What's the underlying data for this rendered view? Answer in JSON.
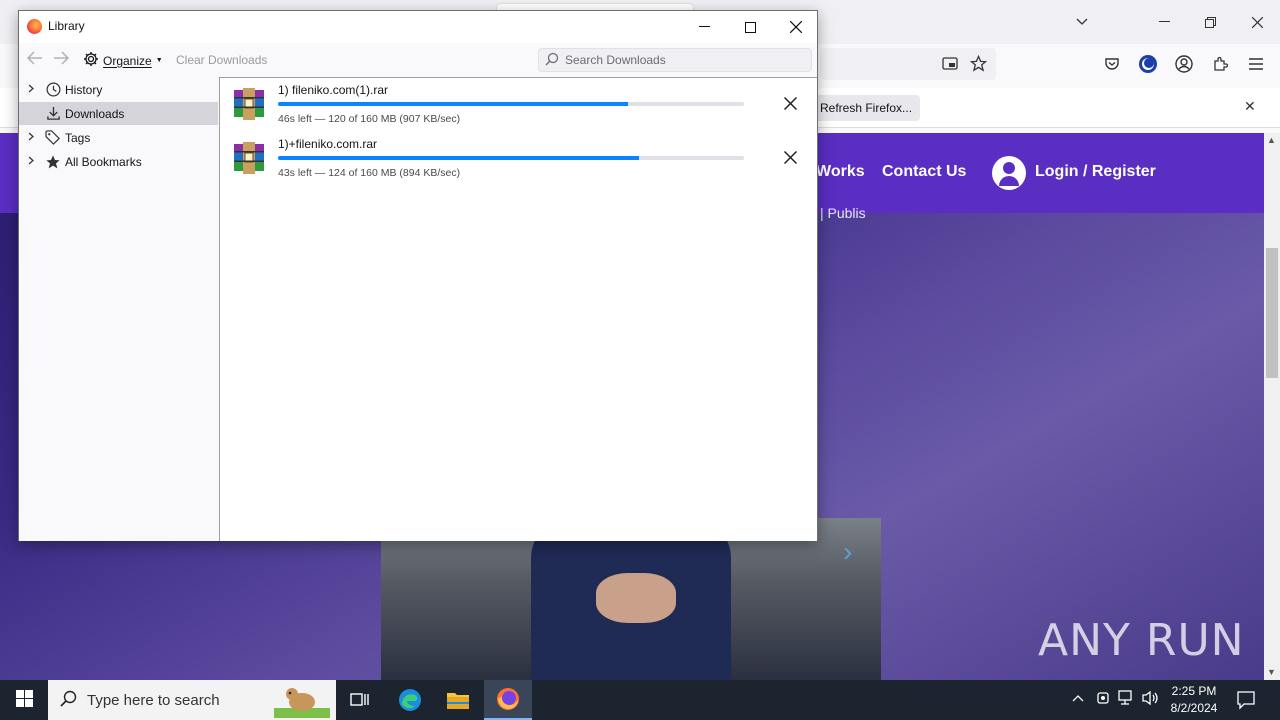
{
  "library": {
    "title": "Library",
    "toolbar": {
      "organize_label": "Organize",
      "clear_downloads_label": "Clear Downloads",
      "search_placeholder": "Search Downloads"
    },
    "sidebar": {
      "items": [
        {
          "label": "History",
          "icon": "clock-icon",
          "expandable": true
        },
        {
          "label": "Downloads",
          "icon": "download-icon",
          "expandable": false,
          "selected": true
        },
        {
          "label": "Tags",
          "icon": "tag-icon",
          "expandable": true
        },
        {
          "label": "All Bookmarks",
          "icon": "star-icon",
          "expandable": true
        }
      ]
    },
    "downloads": [
      {
        "name": "1) fileniko.com(1).rar",
        "status": "46s left — 120 of 160 MB (907 KB/sec)",
        "progress": 0.75
      },
      {
        "name": "1)+fileniko.com.rar",
        "status": "43s left — 124 of 160 MB (894 KB/sec)",
        "progress": 0.775
      }
    ]
  },
  "browser": {
    "notification_button": "Refresh Firefox...",
    "site": {
      "nav_works": "Works",
      "nav_contact": "Contact Us",
      "nav_login": "Login / Register",
      "subtitle": "| Publis"
    },
    "watermark": "ANY RUN"
  },
  "taskbar": {
    "search_placeholder": "Type here to search",
    "time": "2:25 PM",
    "date": "8/2/2024"
  },
  "colors": {
    "accent": "#0a84ff",
    "site_header": "#5a2ec2",
    "taskbar": "#1c2430"
  }
}
